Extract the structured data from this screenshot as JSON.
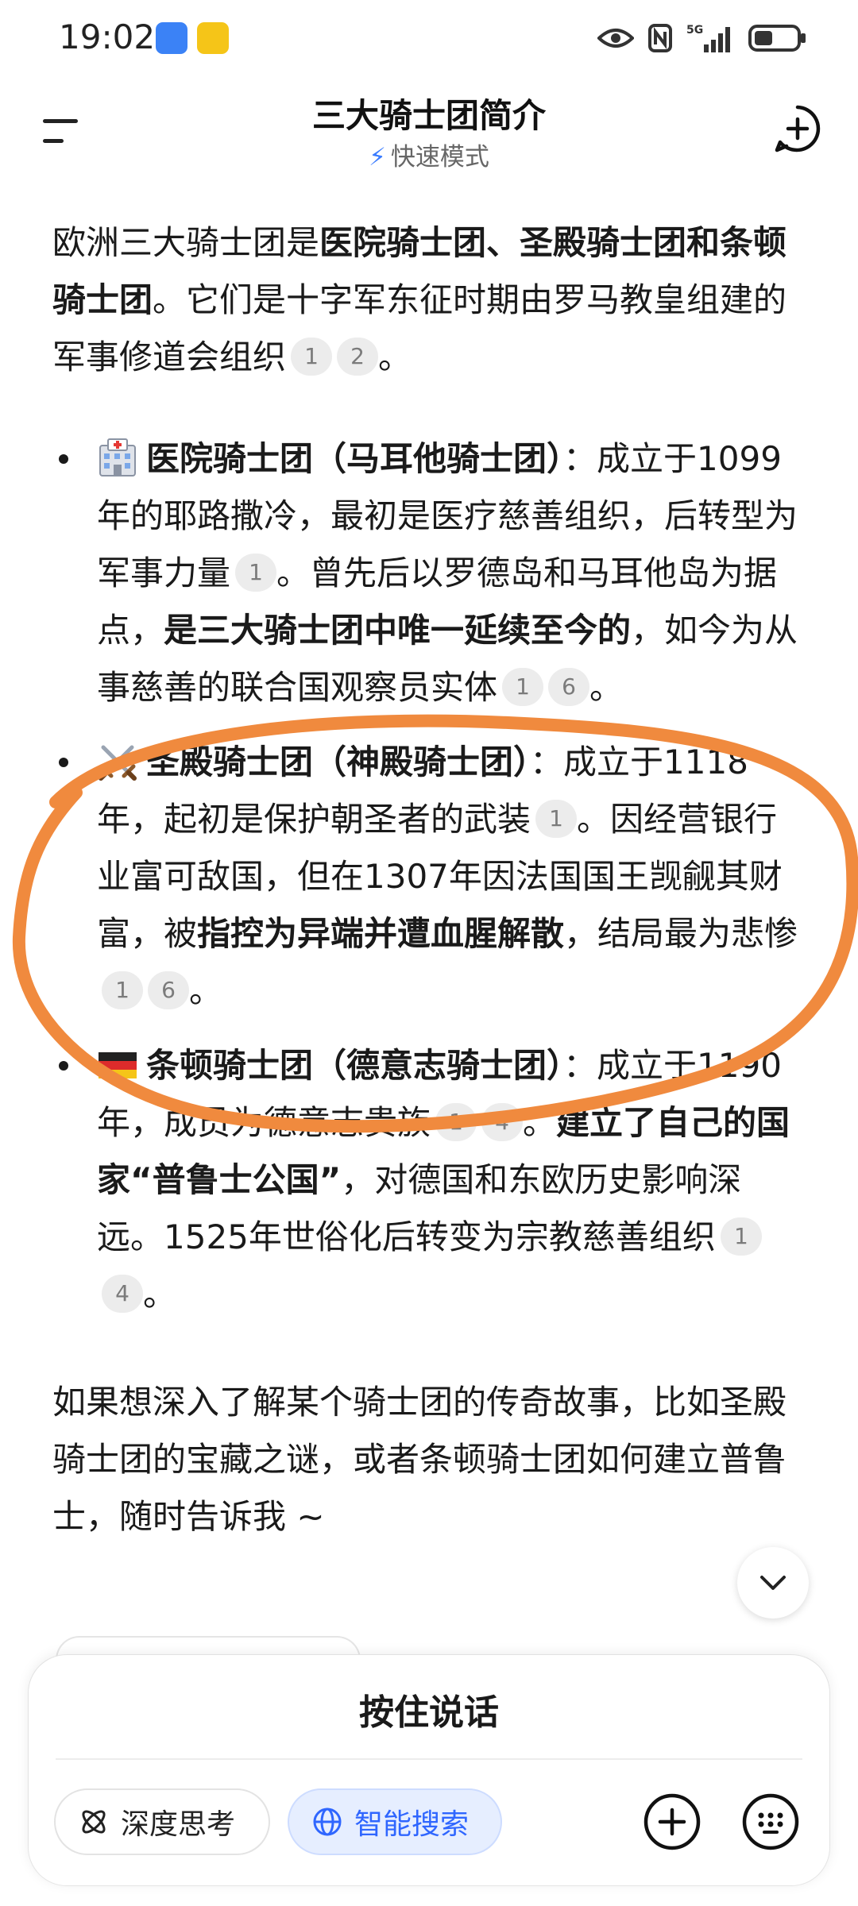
{
  "status_bar": {
    "time": "19:02"
  },
  "header": {
    "title": "三大骑士团简介",
    "mode": "快速模式"
  },
  "content": {
    "intro": {
      "p1": "欧洲三大骑士团是",
      "b1": "医院骑士团、圣殿骑士团和条顿骑士团",
      "p2": "。它们是十字军东征时期由罗马教皇组建的军事修道会组织",
      "c1": "1",
      "c2": "2",
      "end": "。"
    },
    "items": [
      {
        "title": "医院骑士团（马耳他骑士团）",
        "colon": "：",
        "t1": "成立于1099年的耶路撒冷，最初是医疗慈善组织，后转型为军事力量",
        "c1": "1",
        "t2": "。曾先后以罗德岛和马耳他岛为据点，",
        "b1": "是三大骑士团中唯一延续至今的",
        "t3": "，如今为从事慈善的联合国观察员实体",
        "c2": "1",
        "c3": "6",
        "end": "。"
      },
      {
        "title": "圣殿骑士团（神殿骑士团）",
        "colon": "：",
        "t1": "成立于1118年，起初是保护朝圣者的武装",
        "c1": "1",
        "t2": "。因经营银行业富可敌国，但在1307年因法国国王觊觎其财富，被",
        "b1": "指控为异端并遭血腥解散",
        "t3": "，结局最为悲惨",
        "c2": "1",
        "c3": "6",
        "end": "。"
      },
      {
        "title": "条顿骑士团（德意志骑士团）",
        "colon": "：",
        "t1": "成立于1190年，成员为德意志贵族",
        "c1": "1",
        "c2": "4",
        "t2": "。",
        "b1": "建立了自己的国家“普鲁士公国”",
        "t3": "，对德国和东欧历史影响深远。1525年世俗化后转变为宗教慈善组织",
        "c3": "1",
        "c4": "4",
        "end": "。"
      }
    ],
    "closing": "如果想深入了解某个骑士团的传奇故事，比如圣殿骑士团的宝藏之谜，或者条顿骑士团如何建立普鲁士，随时告诉我 ~"
  },
  "input_panel": {
    "hold_to_talk": "按住说话",
    "deep_think": "深度思考",
    "smart_search": "智能搜索"
  },
  "colors": {
    "accent": "#2f66ff",
    "annotation": "#f08a3e"
  }
}
